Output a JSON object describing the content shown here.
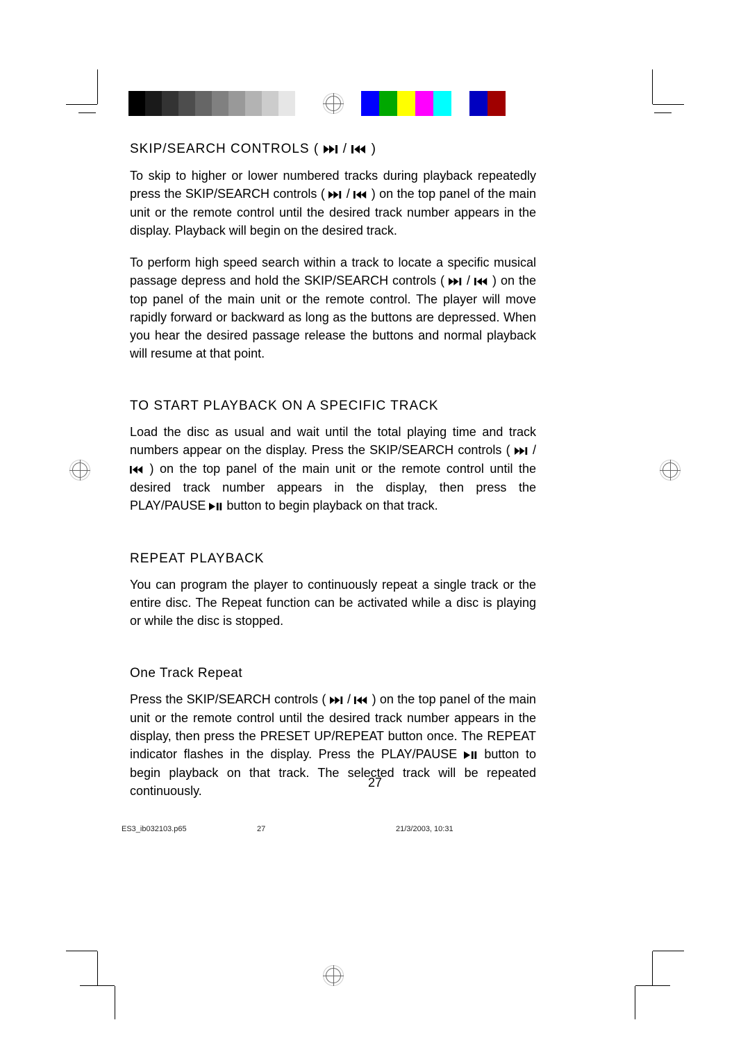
{
  "colorbar_gray": [
    "#000000",
    "#1a1a1a",
    "#333333",
    "#4d4d4d",
    "#666666",
    "#808080",
    "#999999",
    "#b3b3b3",
    "#cccccc",
    "#e6e6e6"
  ],
  "colorbar_color": [
    "#0000ff",
    "#00a800",
    "#ffff00",
    "#ff00ff",
    "#00ffff",
    "#ffffff",
    "#0000c0",
    "#a00000"
  ],
  "sections": {
    "skip": {
      "title_pre": "SKIP/SEARCH CONTROLS (",
      "title_sep": " / ",
      "title_post": ")",
      "p1_a": "To skip to higher or lower numbered tracks during playback repeatedly press the SKIP/SEARCH controls (",
      "p1_sep": " / ",
      "p1_b": ") on the top panel of the main unit or the remote control until the desired track number appears in the display. Playback will begin on the desired track.",
      "p2_a": "To perform high speed search within a track to locate a specific musical passage depress and hold the SKIP/SEARCH controls (",
      "p2_sep": " / ",
      "p2_b": ") on the top panel of the main unit or the remote control. The player will move rapidly forward or backward as long as the buttons are depressed. When you hear the desired passage release the buttons and normal playback will resume at that point."
    },
    "track": {
      "title": "TO START PLAYBACK ON A SPECIFIC TRACK",
      "p_a": "Load the disc as usual and wait until the total playing time and track numbers appear on the display. Press the SKIP/SEARCH controls (",
      "p_sep": " / ",
      "p_b": ") on the top panel of the main unit or the remote control until the desired track number appears in the display, then press the PLAY/PAUSE ",
      "p_c": " button to begin playback on that track."
    },
    "repeat": {
      "title": "REPEAT PLAYBACK",
      "p": "You can program the player to continuously repeat a single track or the entire disc. The Repeat function can be activated while a disc is playing or while the disc is stopped."
    },
    "one": {
      "title": "One Track Repeat",
      "p_a": "Press the SKIP/SEARCH controls (",
      "p_sep": " / ",
      "p_b": ") on the top panel of the main unit or the remote control until the desired track number appears in the display, then press the PRESET UP/REPEAT button once. The REPEAT indicator flashes in the display. Press the PLAY/PAUSE ",
      "p_c": " button to begin playback on that track. The selected track will be repeated continuously."
    }
  },
  "page_number": "27",
  "footer": {
    "file": "ES3_ib032103.p65",
    "pg": "27",
    "date": "21/3/2003, 10:31"
  }
}
